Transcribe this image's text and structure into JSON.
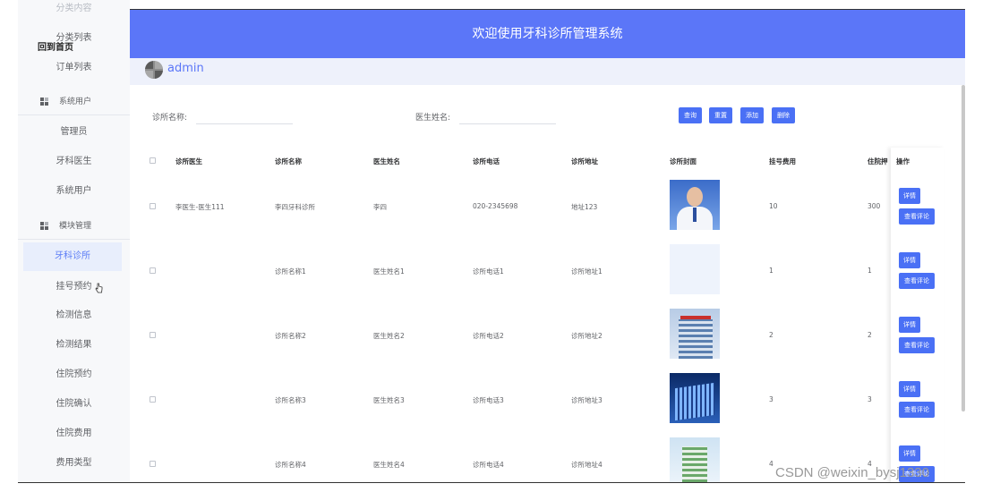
{
  "header": {
    "title": "欢迎使用牙科诊所管理系统"
  },
  "user": {
    "name": "admin"
  },
  "sidebar": {
    "ghost_item": "分类内容",
    "items_top": [
      "分类列表",
      "订单列表"
    ],
    "logo_text": "回到首页",
    "groups": [
      {
        "label": "系统用户",
        "items": [
          "管理员",
          "牙科医生",
          "系统用户"
        ]
      },
      {
        "label": "模块管理",
        "items": [
          "牙科诊所",
          "挂号预约",
          "检测信息",
          "检测结果",
          "住院预约",
          "住院确认",
          "住院费用",
          "费用类型"
        ]
      }
    ],
    "active": "牙科诊所"
  },
  "search": {
    "clinic_label": "诊所名称:",
    "clinic_value": "",
    "doctor_label": "医生姓名:",
    "doctor_value": ""
  },
  "toolbar": {
    "query": "查询",
    "reset": "重置",
    "add": "添加",
    "delete": "删除"
  },
  "table": {
    "headers": [
      "诊所医生",
      "诊所名称",
      "医生姓名",
      "诊所电话",
      "诊所地址",
      "诊所封面",
      "挂号费用",
      "住院押",
      "操作"
    ],
    "rows": [
      {
        "doctor": "李医生-医生111",
        "clinic": "李四牙科诊所",
        "name": "李四",
        "phone": "020-2345698",
        "address": "地址123",
        "cover": "doctor-photo",
        "fee": "10",
        "deposit": "300"
      },
      {
        "doctor": "",
        "clinic": "诊所名称1",
        "name": "医生姓名1",
        "phone": "诊所电话1",
        "address": "诊所地址1",
        "cover": "empty",
        "fee": "1",
        "deposit": "1"
      },
      {
        "doctor": "",
        "clinic": "诊所名称2",
        "name": "医生姓名2",
        "phone": "诊所电话2",
        "address": "诊所地址2",
        "cover": "building-1",
        "fee": "2",
        "deposit": "2"
      },
      {
        "doctor": "",
        "clinic": "诊所名称3",
        "name": "医生姓名3",
        "phone": "诊所电话3",
        "address": "诊所地址3",
        "cover": "building-2",
        "fee": "3",
        "deposit": "3"
      },
      {
        "doctor": "",
        "clinic": "诊所名称4",
        "name": "医生姓名4",
        "phone": "诊所电话4",
        "address": "诊所地址4",
        "cover": "building-3",
        "fee": "4",
        "deposit": "4"
      }
    ],
    "actions": {
      "detail": "详情",
      "reviews": "查看评论"
    }
  },
  "watermark": "CSDN @weixin_bysj1330",
  "colors": {
    "accent": "#5b76f8",
    "button": "#4a70f5",
    "active_bg": "#e8eefc"
  }
}
